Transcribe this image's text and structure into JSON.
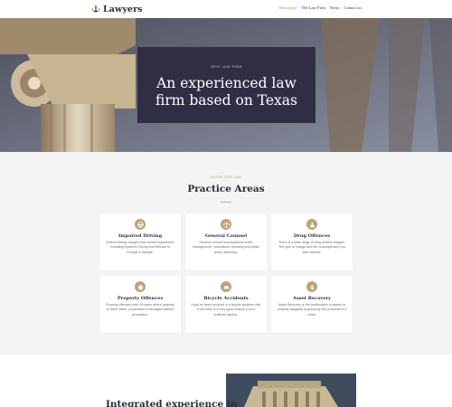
{
  "header": {
    "logo_text": "Lawyers",
    "nav": [
      {
        "label": "Homepage",
        "active": true
      },
      {
        "label": "The Law Firm",
        "active": false
      },
      {
        "label": "News",
        "active": false
      },
      {
        "label": "Contact us",
        "active": false
      }
    ]
  },
  "hero": {
    "eyebrow": "DEVI LAW FIRM",
    "title_line1": "An experienced law",
    "title_line2": "firm based on Texas"
  },
  "practice": {
    "eyebrow": "ENTER OUR LAW",
    "title": "Practice Areas",
    "cards": [
      {
        "icon": "steering-wheel-icon",
        "title": "Impaired Driving",
        "text": "Defend driving charges that involve impairment, including Impaired Driving and Refusal to Provide a Sample."
      },
      {
        "icon": "scales-icon",
        "title": "General Counsel",
        "text": "General counsel encompasses entire management, compliance reporting and public policy advocacy."
      },
      {
        "icon": "flask-icon",
        "title": "Drug Offences",
        "text": "There is a wide range of drug related charges. The type of charge and the consequences you face depend."
      },
      {
        "icon": "home-icon",
        "title": "Property Offences",
        "text": "Property offences refer to cases where property is either taken, possessed or damaged without permission."
      },
      {
        "icon": "car-icon",
        "title": "Bicycle Accidents",
        "text": "If you've been involved in a bicycle accident with a car there is a very good chance you've suffered injuries."
      },
      {
        "icon": "dollar-icon",
        "title": "Asset Recovery",
        "text": "Asset Recovery is the confiscation of assets or property allegedly acquired by the proceeds of a crime."
      }
    ]
  },
  "integrated": {
    "title": "Integrated experience in"
  },
  "colors": {
    "accent": "#b89a6e",
    "dark": "#2f2e45",
    "section_bg": "#f4f4f4"
  }
}
